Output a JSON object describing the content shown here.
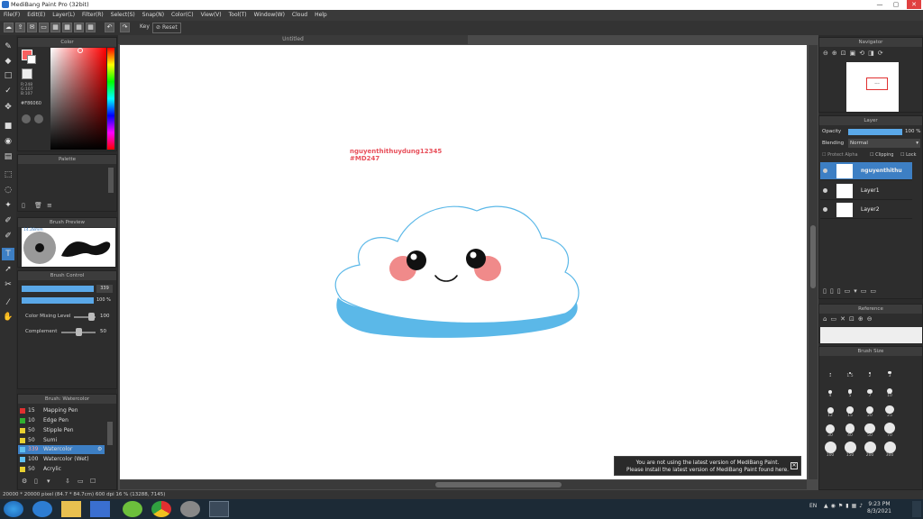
{
  "window": {
    "title": "MediBang Paint Pro (32bit)",
    "min": "—",
    "max": "▢",
    "close": "✕"
  },
  "menu": [
    "File(F)",
    "Edit(E)",
    "Layer(L)",
    "Filter(R)",
    "Select(S)",
    "Snap(N)",
    "Color(C)",
    "View(V)",
    "Tool(T)",
    "Window(W)",
    "Cloud",
    "Help"
  ],
  "toolbar": {
    "key_label": "Key",
    "reset_label": "Reset"
  },
  "document": {
    "tab": "Untitled"
  },
  "color_panel": {
    "title": "Color",
    "r": "R:248",
    "g": "G:107",
    "b": "B:107",
    "hex": "#F86060"
  },
  "palette_panel": {
    "title": "Palette"
  },
  "brush_preview": {
    "title": "Brush Preview",
    "size": "14.28mm"
  },
  "brush_control": {
    "title": "Brush Control",
    "size_value": "339",
    "opacity_value": "100 %",
    "mixing_label": "Color Mixing Level",
    "mixing_value": "100",
    "complement_label": "Complement",
    "complement_value": "50"
  },
  "brush_panel": {
    "title": "Brush: Watercolor",
    "items": [
      {
        "size": "15",
        "name": "Mapping Pen",
        "color": "#e03030"
      },
      {
        "size": "10",
        "name": "Edge Pen",
        "color": "#30b030"
      },
      {
        "size": "50",
        "name": "Stipple Pen",
        "color": "#e8d030"
      },
      {
        "size": "50",
        "name": "Sumi",
        "color": "#e8d030"
      },
      {
        "size": "339",
        "name": "Watercolor",
        "color": "#60c0f0",
        "selected": true
      },
      {
        "size": "100",
        "name": "Watercolor (Wet)",
        "color": "#60c0f0"
      },
      {
        "size": "50",
        "name": "Acrylic",
        "color": "#e8d030"
      }
    ]
  },
  "canvas": {
    "watermark_line1": "nguyenthithuydung12345",
    "watermark_line2": "#MD247"
  },
  "notice": {
    "line1": "You are not using the latest version of MediBang Paint.",
    "line2": "Please install the latest version of MediBang Paint found here."
  },
  "navigator": {
    "title": "Navigator",
    "thumb_text": "..."
  },
  "layer_panel": {
    "title": "Layer",
    "opacity_label": "Opacity",
    "opacity_value": "100 %",
    "blending_label": "Blending",
    "blending_value": "Normal",
    "protect_alpha": "Protect Alpha",
    "clipping": "Clipping",
    "lock": "Lock",
    "layers": [
      {
        "name": "nguyenthithu",
        "selected": true
      },
      {
        "name": "Layer1"
      },
      {
        "name": "Layer2"
      }
    ]
  },
  "reference_panel": {
    "title": "Reference"
  },
  "brush_size_panel": {
    "title": "Brush Size",
    "sizes": [
      "1",
      "1.5",
      "2",
      "3",
      "4",
      "5",
      "7",
      "10",
      "12",
      "15",
      "20",
      "25",
      "30",
      "40",
      "50",
      "70",
      "100",
      "150",
      "200",
      "300"
    ]
  },
  "statusbar": {
    "text": "20000 * 20000 pixel  (84.7 * 84.7cm)  600 dpi  16 %  (13288, 7145)"
  },
  "taskbar": {
    "lang": "EN",
    "time": "9:23 PM",
    "date": "8/3/2021"
  },
  "colors": {
    "accent": "#3d7fc4",
    "primary_color": "#f86060",
    "cloud_blue": "#5bb8e8",
    "blush": "#f08a8a"
  }
}
